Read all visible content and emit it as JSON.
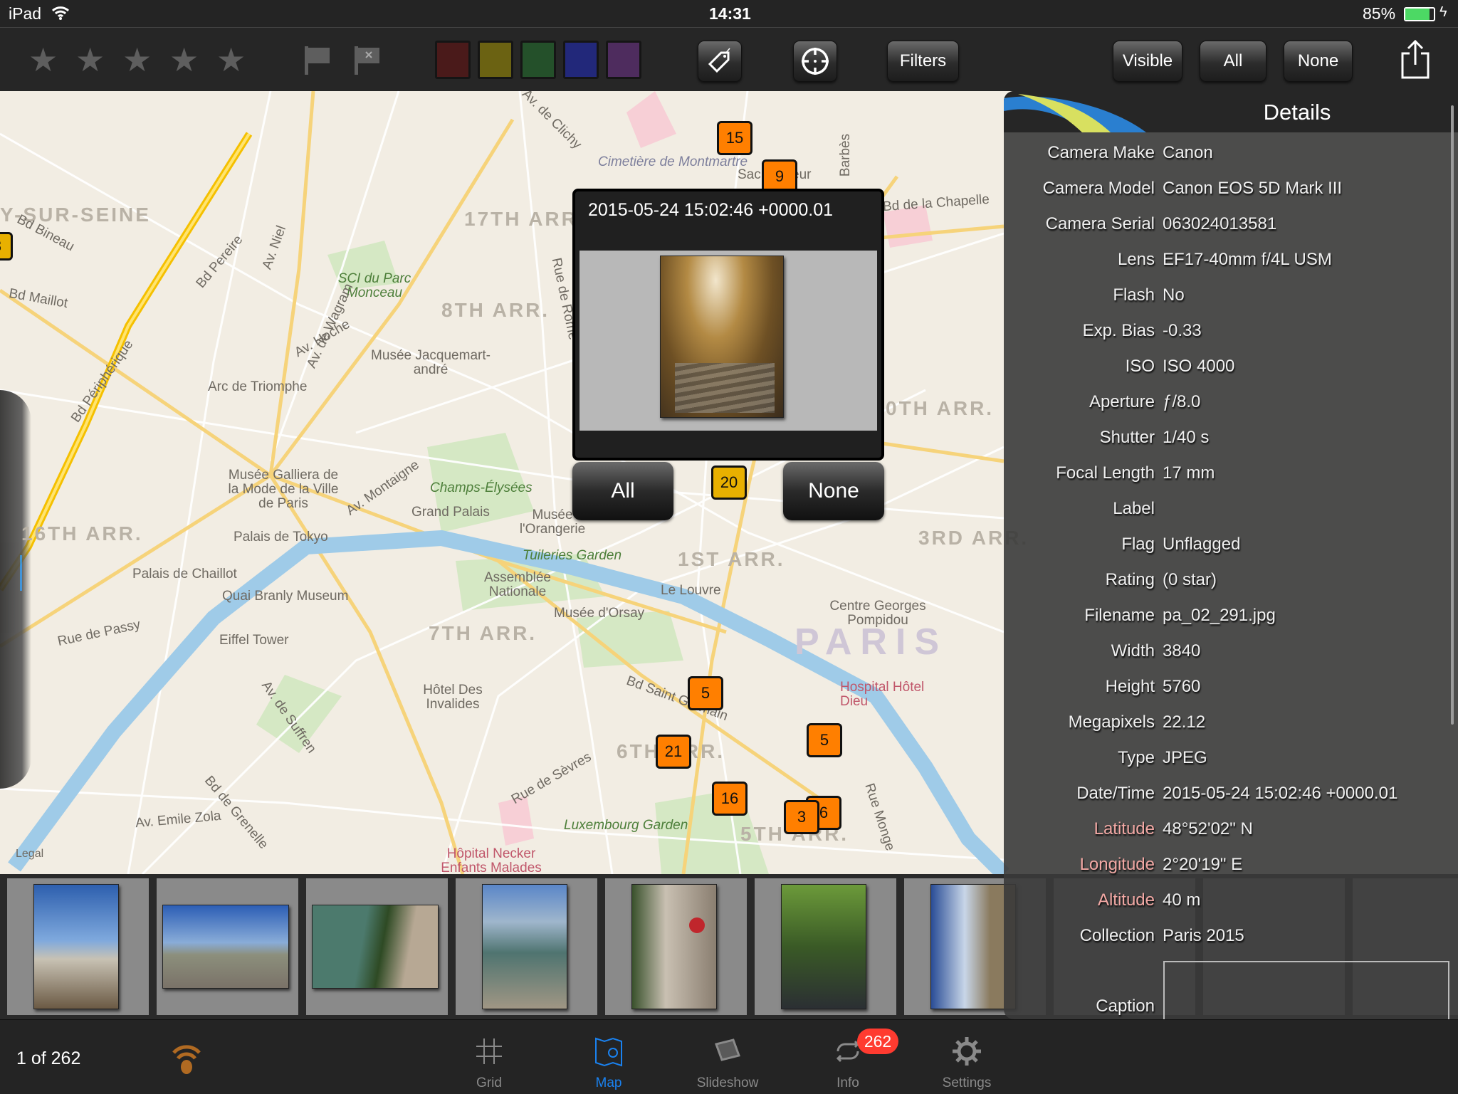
{
  "status_bar": {
    "device": "iPad",
    "time": "14:31",
    "battery": "85%",
    "battery_level": 0.85,
    "battery_color": "#4cd964"
  },
  "toolbar": {
    "rating_stars": 5,
    "flags": [
      "flag-icon",
      "reject-flag-icon"
    ],
    "color_labels": [
      "#4a1a1a",
      "#6b6212",
      "#24502a",
      "#22287a",
      "#4e2c5e"
    ],
    "tag_icon": "tag-icon",
    "locate_icon": "crosshair-icon",
    "filters_label": "Filters",
    "visible_label": "Visible",
    "all_label": "All",
    "none_label": "None",
    "share_icon": "share-icon"
  },
  "map": {
    "labels": [
      "Cimetière de Montmartre",
      "17TH ARR.",
      "8TH ARR.",
      "SCI du Parc Monceau",
      "Musée Jacquemart-andré",
      "Arc de Triomphe",
      "Musée Galliera de la Mode de la Ville de Paris",
      "Champs-Élysées",
      "Grand Palais",
      "Musée l'Orangerie",
      "Palais de Tokyo",
      "16TH ARR.",
      "Palais de Chaillot",
      "Quai Branly Museum",
      "Tuileries Garden",
      "Assemblée Nationale",
      "1ST ARR.",
      "Le Louvre",
      "Musée d'Orsay",
      "7TH ARR.",
      "Eiffel Tower",
      "Centre Georges Pompidou",
      "PARIS",
      "3RD ARR.",
      "0TH ARR.",
      "Hôtel Des Invalides",
      "Hospital Hôtel Dieu",
      "6TH ARR.",
      "Luxembourg Garden",
      "5TH ARR.",
      "Hôpital Necker Enfants Malades",
      "Y-SUR-SEINE",
      "Legal",
      "Bd Bineau",
      "Bd Maillot",
      "Bd Périphérique",
      "Av. de Wagram",
      "Av. Hoche",
      "Av. Montaigne",
      "Rue de Passy",
      "Av. de Suffren",
      "Bd de Grenelle",
      "Av. Emile Zola",
      "Rue de Sèvres",
      "Bd Saint Germain",
      "Rue Monge",
      "Barbès",
      "Bd de la Chapelle",
      "Sacré Cœur",
      "Av. de Clichy",
      "Rue de Rome",
      "Bd Pereire",
      "Av. Niel"
    ],
    "markers": [
      "15",
      "9",
      "20",
      "5",
      "21",
      "5",
      "16",
      "3",
      "6",
      "3"
    ],
    "marker_color": "#ff7f00",
    "selected_marker_color": "#e8b000"
  },
  "popup": {
    "datetime": "2015-05-24 15:02:46 +0000.01",
    "all_label": "All",
    "none_label": "None"
  },
  "details": {
    "title": "Details",
    "rows": [
      {
        "label": "Camera Make",
        "value": "Canon"
      },
      {
        "label": "Camera Model",
        "value": "Canon EOS 5D Mark III"
      },
      {
        "label": "Camera Serial",
        "value": "063024013581"
      },
      {
        "label": "Lens",
        "value": "EF17-40mm f/4L USM"
      },
      {
        "label": "Flash",
        "value": "No"
      },
      {
        "label": "Exp. Bias",
        "value": "-0.33"
      },
      {
        "label": "ISO",
        "value": "ISO 4000"
      },
      {
        "label": "Aperture",
        "value": "ƒ/8.0"
      },
      {
        "label": "Shutter",
        "value": "1/40 s"
      },
      {
        "label": "Focal Length",
        "value": "17 mm"
      },
      {
        "label": "Label",
        "value": ""
      },
      {
        "label": "Flag",
        "value": "Unflagged"
      },
      {
        "label": "Rating",
        "value": "(0 star)"
      },
      {
        "label": "Filename",
        "value": "pa_02_291.jpg"
      },
      {
        "label": "Width",
        "value": "3840"
      },
      {
        "label": "Height",
        "value": "5760"
      },
      {
        "label": "Megapixels",
        "value": "22.12"
      },
      {
        "label": "Type",
        "value": "JPEG"
      },
      {
        "label": "Date/Time",
        "value": "2015-05-24 15:02:46 +0000.01"
      },
      {
        "label": "Latitude",
        "value": "48°52'02\" N"
      },
      {
        "label": "Longitude",
        "value": "2°20'19\" E"
      },
      {
        "label": "Altitude",
        "value": "40 m"
      },
      {
        "label": "Collection",
        "value": "Paris 2015"
      }
    ],
    "caption_label": "Caption",
    "caption_value": "",
    "geo_label_color": "#f3a9a5"
  },
  "bottom": {
    "counter": "1 of 262",
    "tabs": [
      {
        "label": "Grid",
        "icon": "grid-icon"
      },
      {
        "label": "Map",
        "icon": "map-icon",
        "active": true
      },
      {
        "label": "Slideshow",
        "icon": "slideshow-icon"
      },
      {
        "label": "Info",
        "icon": "sync-icon",
        "badge": "262"
      },
      {
        "label": "Settings",
        "icon": "gear-icon"
      }
    ],
    "active_color": "#1a82f0",
    "badge_color": "#ff3b30"
  }
}
